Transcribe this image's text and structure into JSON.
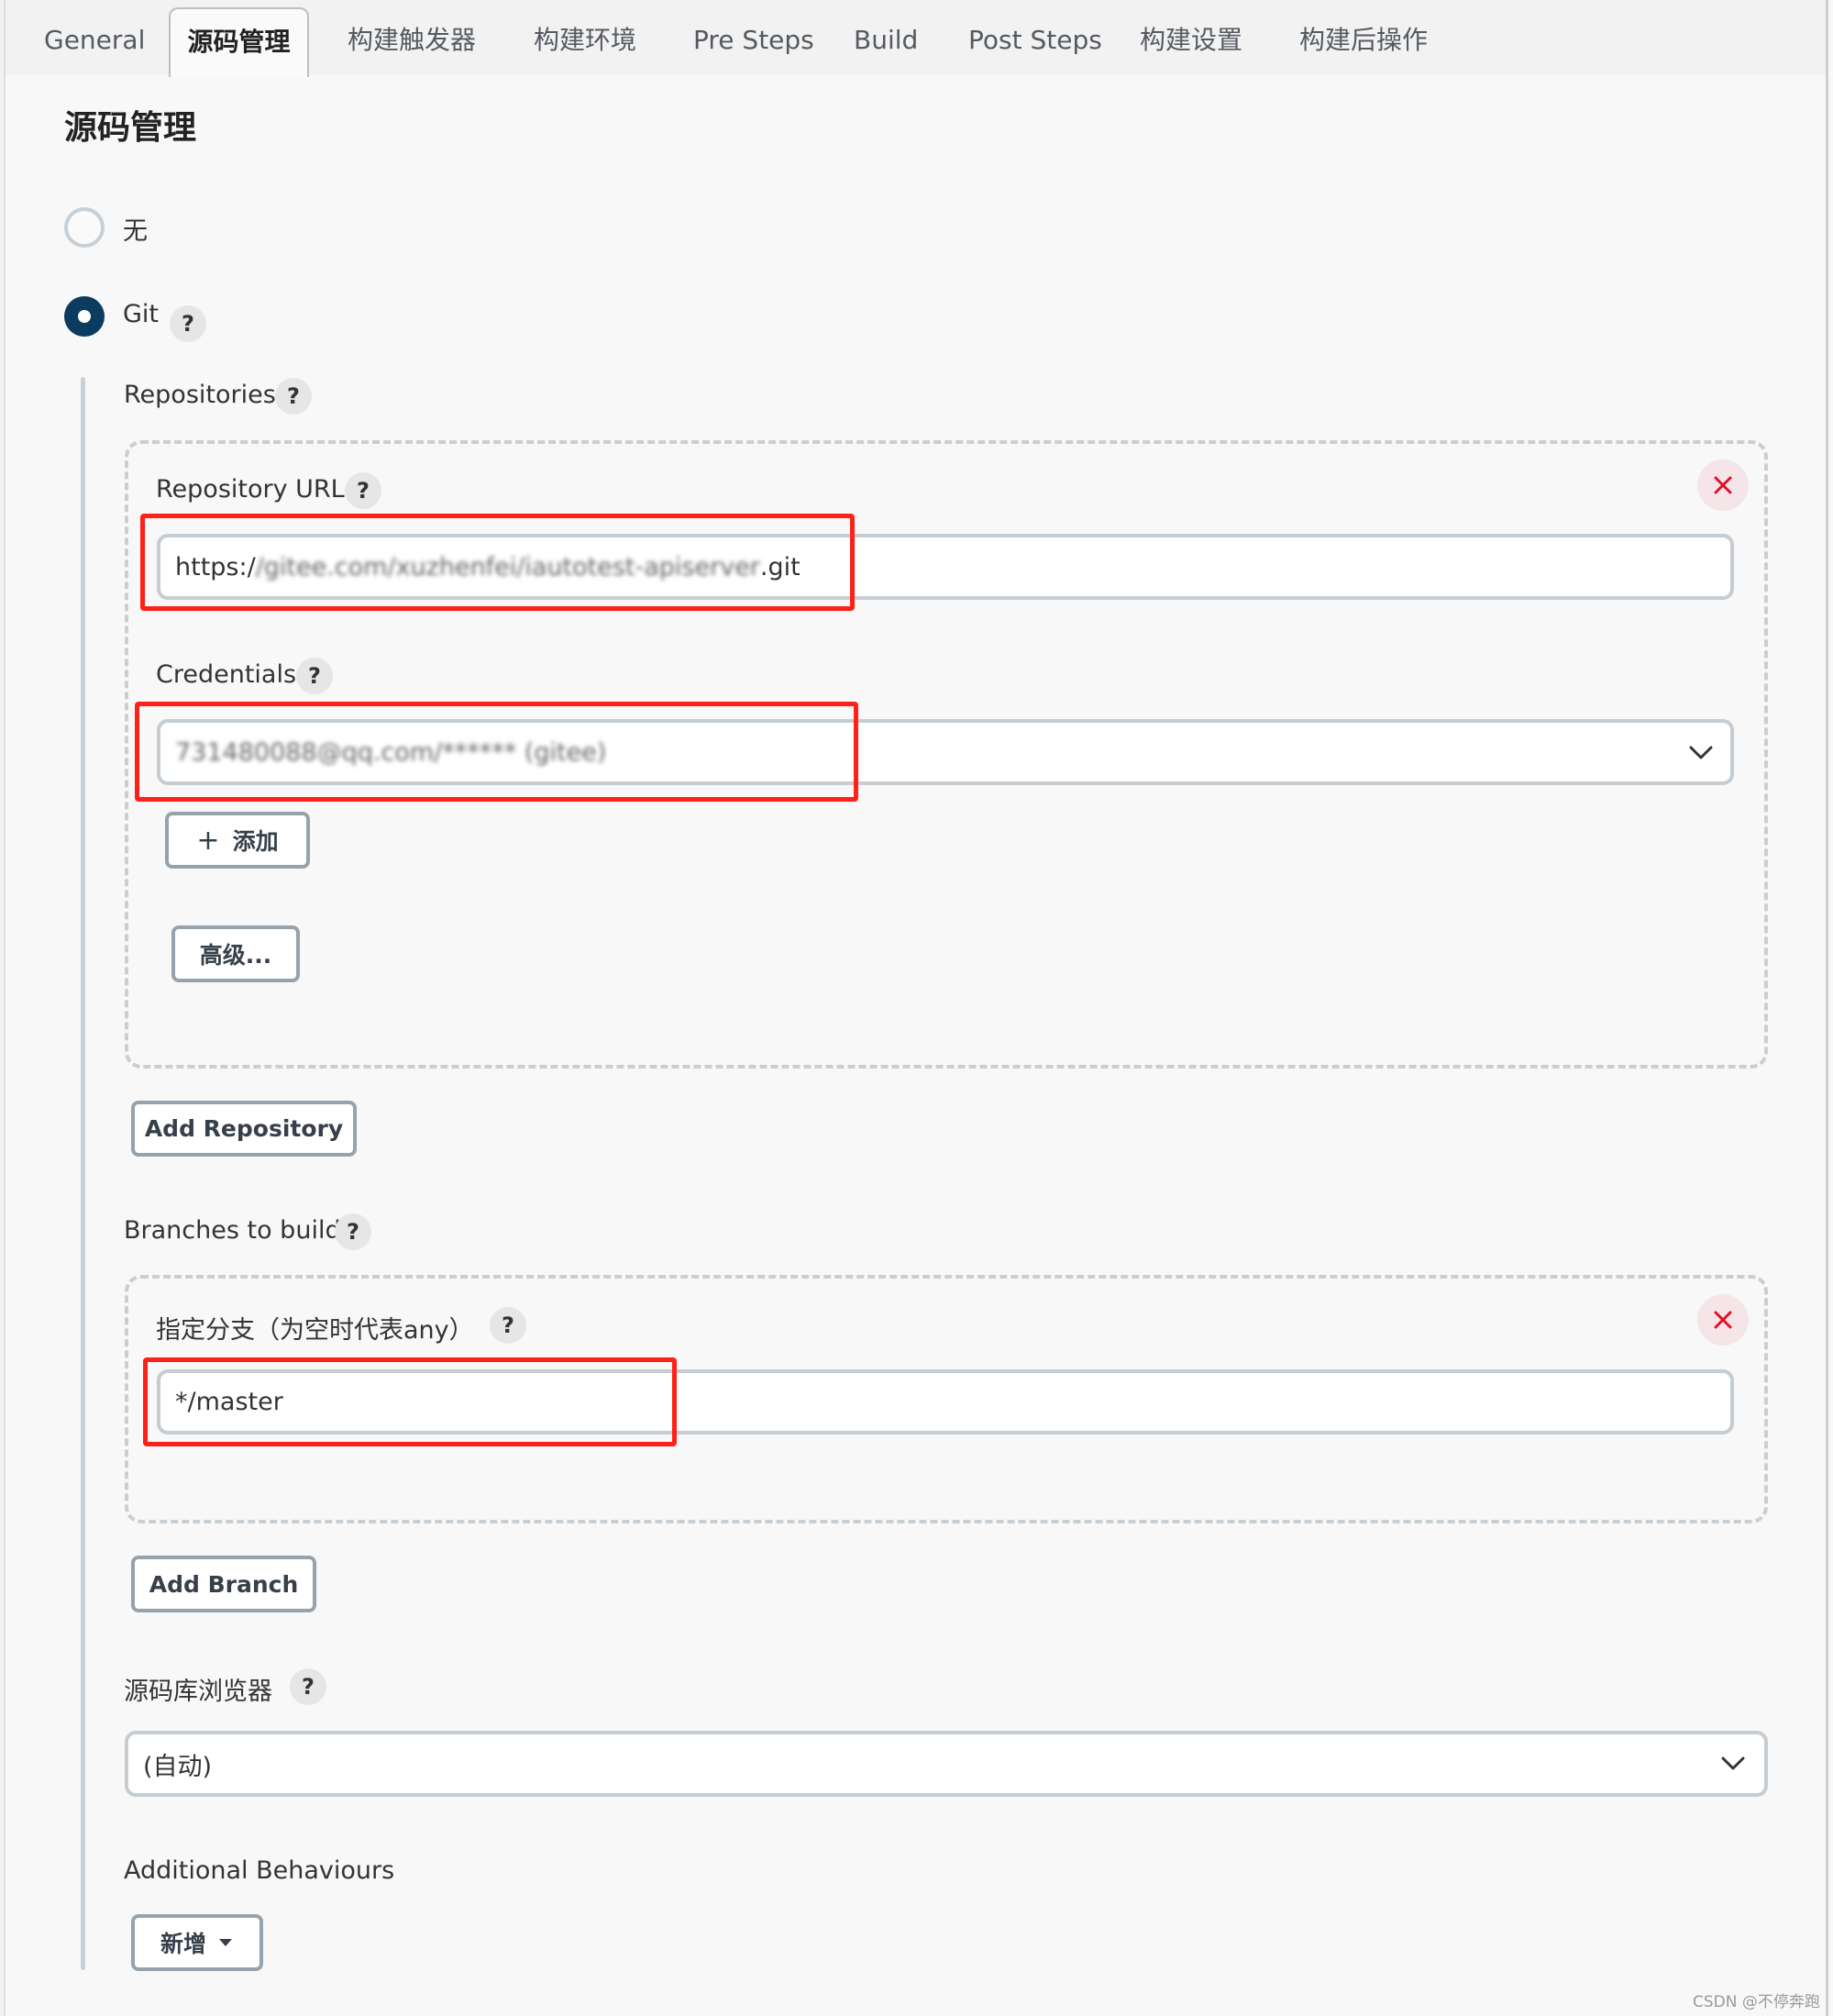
{
  "tabs": [
    {
      "label": "General",
      "active": false
    },
    {
      "label": "源码管理",
      "active": true
    },
    {
      "label": "构建触发器",
      "active": false
    },
    {
      "label": "构建环境",
      "active": false
    },
    {
      "label": "Pre Steps",
      "active": false
    },
    {
      "label": "Build",
      "active": false
    },
    {
      "label": "Post Steps",
      "active": false
    },
    {
      "label": "构建设置",
      "active": false
    },
    {
      "label": "构建后操作",
      "active": false
    }
  ],
  "section_title": "源码管理",
  "scm_options": [
    {
      "label": "无",
      "selected": false
    },
    {
      "label": "Git",
      "selected": true
    }
  ],
  "help_glyph": "?",
  "repositories": {
    "label": "Repositories",
    "repository_url": {
      "label": "Repository URL",
      "value_prefix": "https:/",
      "value_blurred": "/gitee.com/xuzhenfei/iautotest-apiserver",
      "value_suffix": ".git"
    },
    "credentials": {
      "label": "Credentials",
      "selected_blurred": "731480088@qq.com/****** (gitee)"
    },
    "add_credentials_button": "添加",
    "advanced_button": "高级...",
    "add_repository_button": "Add Repository"
  },
  "branches": {
    "label": "Branches to build",
    "branch_specifier_label": "指定分支（为空时代表any）",
    "branch_value": "*/master",
    "add_branch_button": "Add Branch"
  },
  "repository_browser": {
    "label": "源码库浏览器",
    "selected": "(自动)"
  },
  "additional_behaviours": {
    "label": "Additional Behaviours",
    "add_button": "新增"
  },
  "watermark": "CSDN @不停奔跑",
  "colors": {
    "radio_selected": "#0b3b5e",
    "delete_icon": "#e0102b",
    "highlight_box": "#ff2018"
  }
}
